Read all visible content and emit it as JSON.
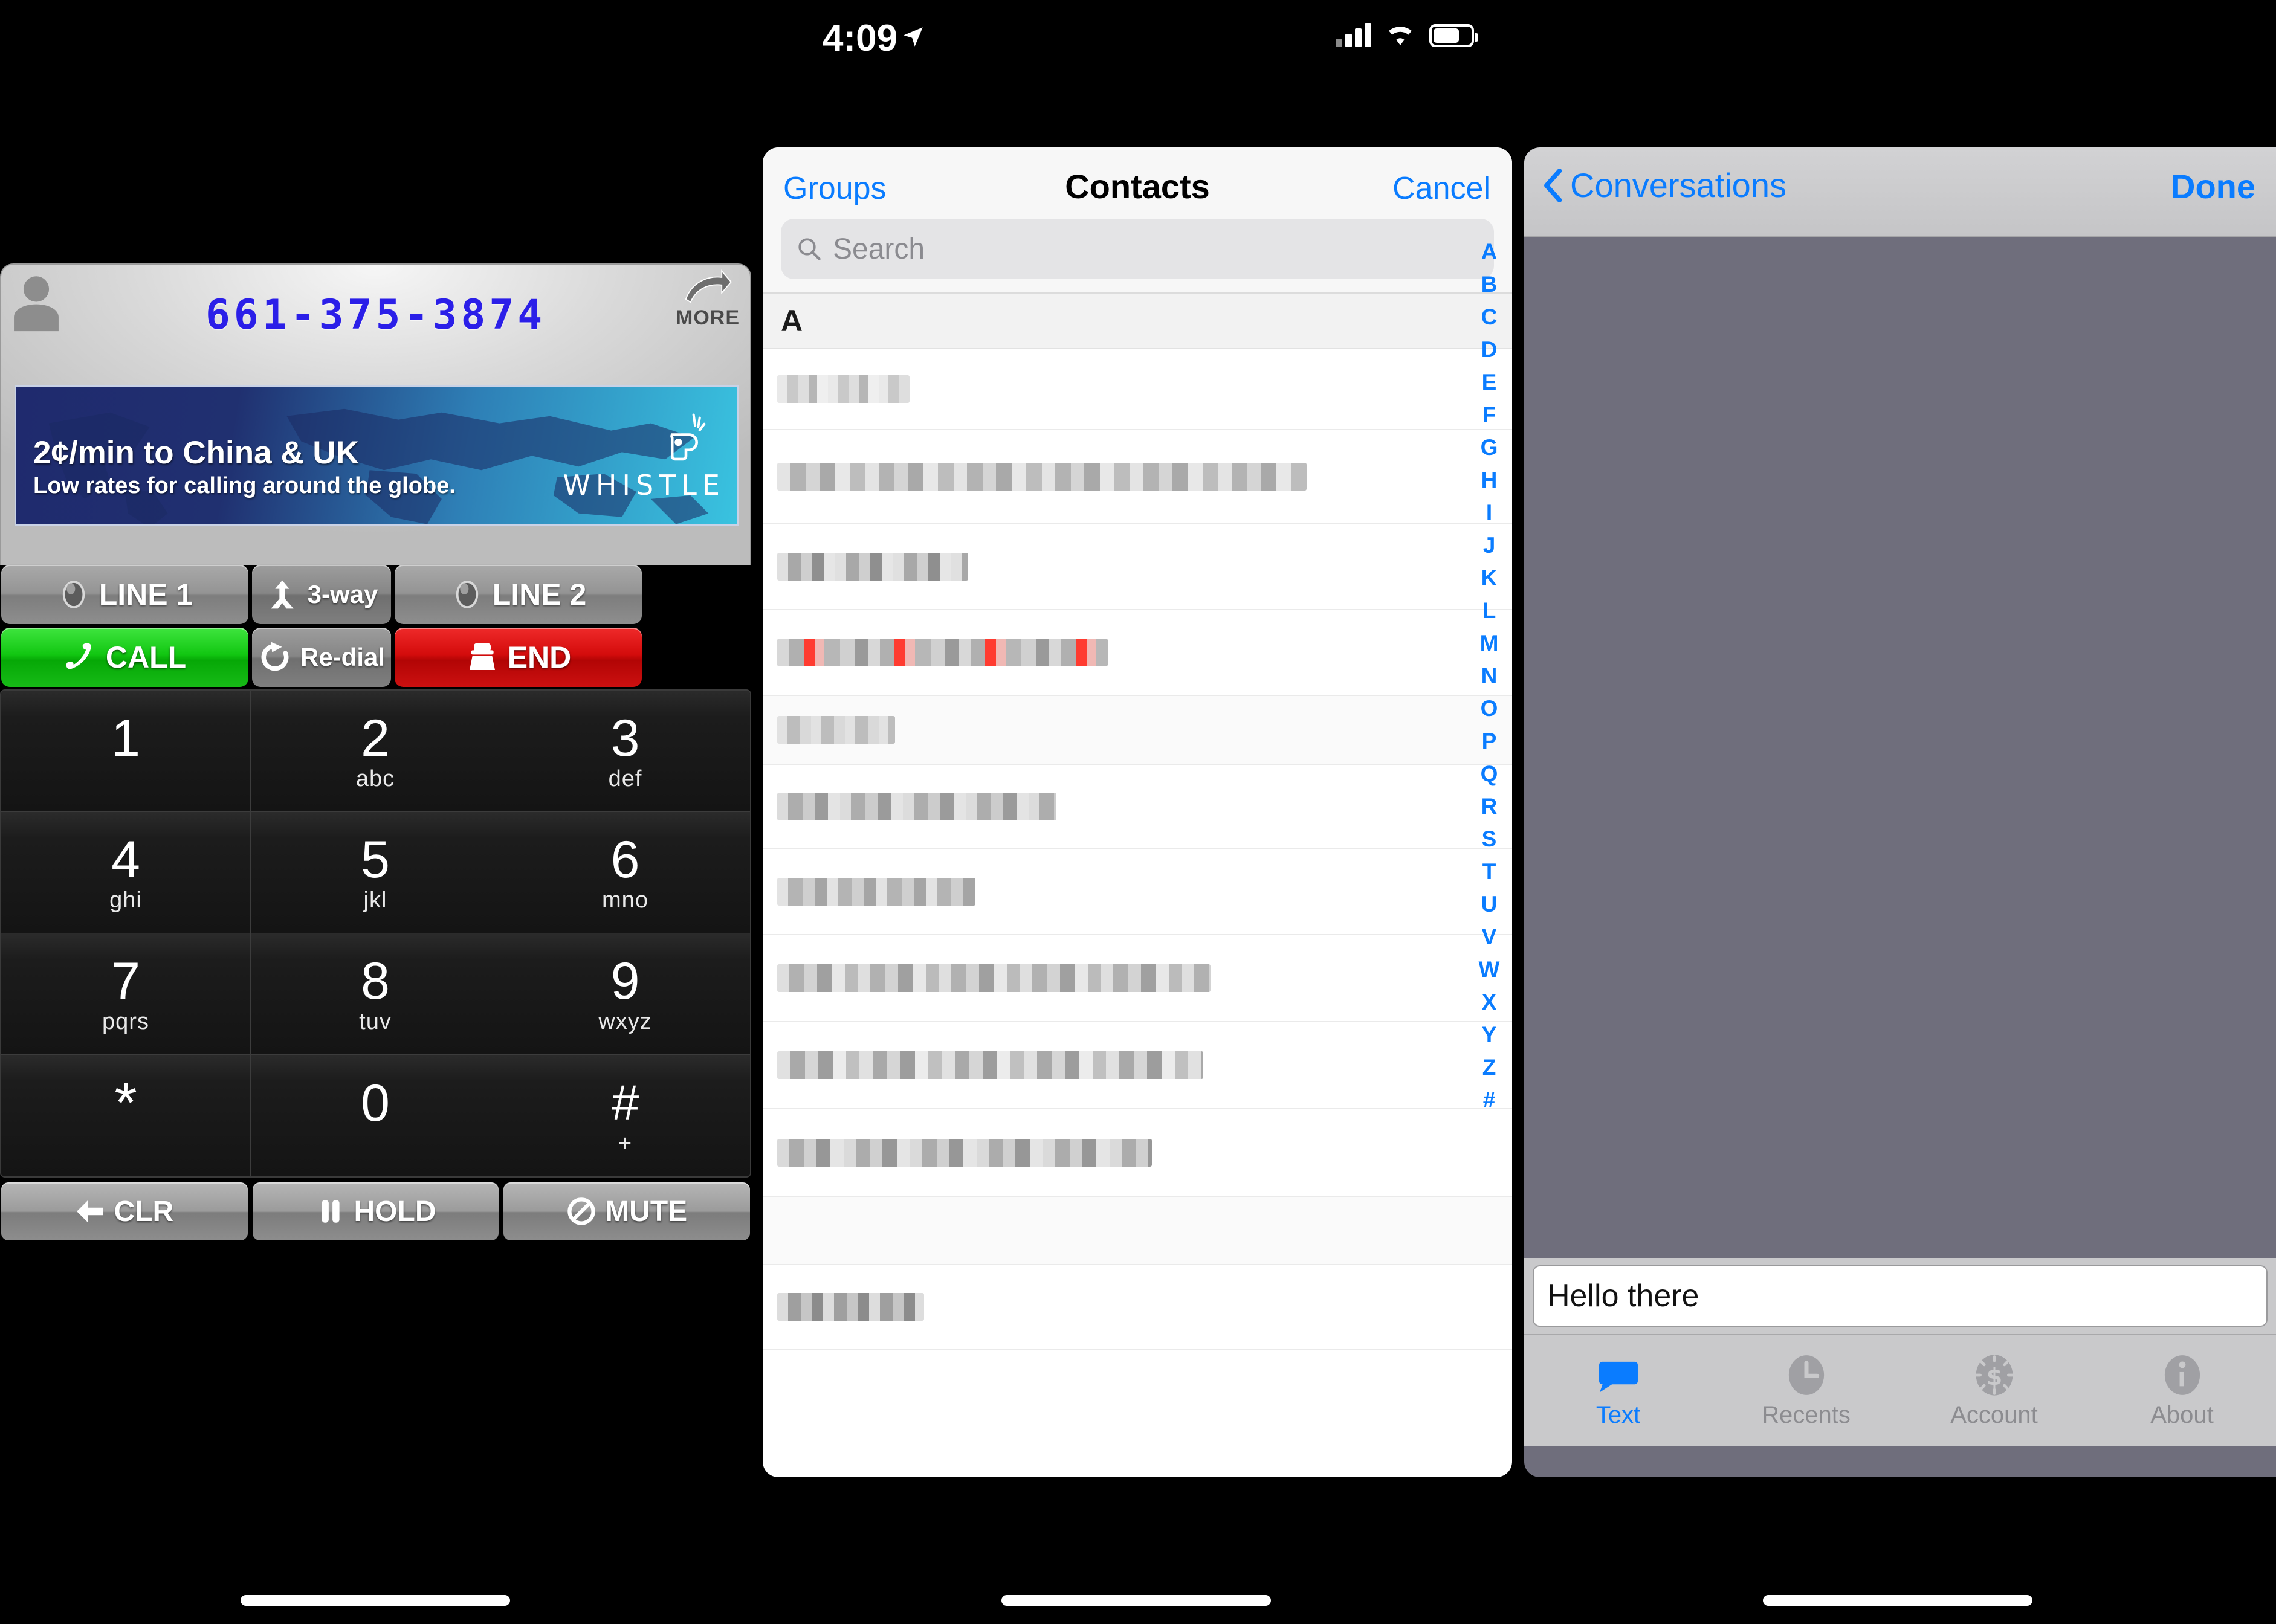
{
  "status_bar": {
    "time": "4:09",
    "location_icon": "location-arrow-icon",
    "signal_icon": "cellular-signal-icon",
    "wifi_icon": "wifi-icon",
    "battery_icon": "battery-icon"
  },
  "dialer": {
    "contact_icon": "person-silhouette-icon",
    "phone_number": "661-375-3874",
    "more_label": "MORE",
    "more_icon": "curved-arrow-icon",
    "ad": {
      "headline": "2¢/min to China & UK",
      "subline": "Low rates for calling around the globe.",
      "brand": "WHISTLE",
      "brand_icon": "whistle-icon"
    },
    "line_buttons": [
      {
        "label": "LINE 1",
        "icon": "led-indicator-icon",
        "style": "grey"
      },
      {
        "label": "3-way",
        "icon": "merge-arrows-icon",
        "style": "grey2"
      },
      {
        "label": "LINE 2",
        "icon": "led-indicator-icon",
        "style": "grey"
      }
    ],
    "action_buttons": [
      {
        "label": "CALL",
        "icon": "phone-handset-icon",
        "style": "green"
      },
      {
        "label": "Re-dial",
        "icon": "redial-circular-arrow-icon",
        "style": "grey2"
      },
      {
        "label": "END",
        "icon": "phone-hangup-icon",
        "style": "red"
      }
    ],
    "keypad": [
      {
        "digit": "1",
        "letters": ""
      },
      {
        "digit": "2",
        "letters": "abc"
      },
      {
        "digit": "3",
        "letters": "def"
      },
      {
        "digit": "4",
        "letters": "ghi"
      },
      {
        "digit": "5",
        "letters": "jkl"
      },
      {
        "digit": "6",
        "letters": "mno"
      },
      {
        "digit": "7",
        "letters": "pqrs"
      },
      {
        "digit": "8",
        "letters": "tuv"
      },
      {
        "digit": "9",
        "letters": "wxyz"
      },
      {
        "digit": "*",
        "letters": ""
      },
      {
        "digit": "0",
        "letters": ""
      },
      {
        "digit": "#",
        "letters": "+"
      }
    ],
    "bottom_buttons": [
      {
        "label": "CLR",
        "icon": "back-arrow-icon"
      },
      {
        "label": "HOLD",
        "icon": "pause-icon"
      },
      {
        "label": "MUTE",
        "icon": "no-entry-icon"
      }
    ]
  },
  "contacts": {
    "groups_label": "Groups",
    "title": "Contacts",
    "cancel_label": "Cancel",
    "search": {
      "placeholder": "Search",
      "value": "",
      "icon": "search-icon"
    },
    "section_letter": "A",
    "rows": [
      {
        "redacted": true,
        "width_pct": 18
      },
      {
        "redacted": true,
        "width_pct": 73
      },
      {
        "redacted": true,
        "width_pct": 26
      },
      {
        "redacted": true,
        "width_pct": 45,
        "accent": "#ff3b30"
      },
      {
        "redacted": true,
        "width_pct": 37
      },
      {
        "redacted": true,
        "width_pct": 27
      },
      {
        "redacted": true,
        "width_pct": 59
      },
      {
        "redacted": true,
        "width_pct": 58
      },
      {
        "redacted": true,
        "width_pct": 51
      },
      {
        "redacted": true,
        "width_pct": 20
      }
    ],
    "index": [
      "A",
      "B",
      "C",
      "D",
      "E",
      "F",
      "G",
      "H",
      "I",
      "J",
      "K",
      "L",
      "M",
      "N",
      "O",
      "P",
      "Q",
      "R",
      "S",
      "T",
      "U",
      "V",
      "W",
      "X",
      "Y",
      "Z",
      "#"
    ]
  },
  "messages": {
    "back_label": "Conversations",
    "back_icon": "chevron-left-icon",
    "done_label": "Done",
    "compose": {
      "value": "Hello there",
      "placeholder": ""
    },
    "tabs": [
      {
        "label": "Text",
        "icon": "chat-bubble-icon",
        "active": true
      },
      {
        "label": "Recents",
        "icon": "clock-icon",
        "active": false
      },
      {
        "label": "Account",
        "icon": "dollar-coin-icon",
        "active": false
      },
      {
        "label": "About",
        "icon": "info-icon",
        "active": false
      }
    ]
  },
  "colors": {
    "ios_blue": "#0a7cff",
    "call_green": "#12c712",
    "end_red": "#d40c0c",
    "dial_number_blue": "#2b1fe8",
    "message_bg": "#6f6e7c"
  }
}
